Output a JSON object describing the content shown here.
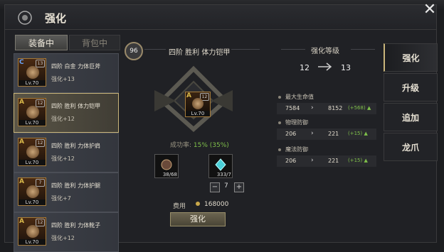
{
  "header": {
    "title": "强化"
  },
  "tabs": [
    "装备中",
    "背包中"
  ],
  "equipment_list": [
    {
      "grade": "C",
      "stars": "13",
      "level": "Lv.70",
      "name": "四阶 白金 力体巨斧",
      "enhance": "强化+13"
    },
    {
      "grade": "A",
      "stars": "12",
      "level": "Lv.70",
      "name": "四阶 胜利 体力铠甲",
      "enhance": "强化+12"
    },
    {
      "grade": "A",
      "stars": "12",
      "level": "Lv.70",
      "name": "四阶 胜利 力体护肩",
      "enhance": "强化+12"
    },
    {
      "grade": "A",
      "stars": "7",
      "level": "Lv.70",
      "name": "四阶 胜利 力体护腿",
      "enhance": "强化+7"
    },
    {
      "grade": "A",
      "stars": "12",
      "level": "Lv.70",
      "name": "四阶 胜利 力体靴子",
      "enhance": "强化+12"
    }
  ],
  "center": {
    "level_badge": "96",
    "item_title": "四阶 胜利 体力铠甲",
    "item": {
      "grade": "A",
      "stars": "12",
      "level": "Lv.70"
    },
    "success_label": "成功率:",
    "success_value": "15% (35%)",
    "materials": [
      {
        "count": "38/68"
      },
      {
        "count": "333/7"
      }
    ],
    "quantity": "7",
    "minus": "−",
    "plus": "+",
    "fee_label": "费用",
    "fee_value": "168000",
    "enhance_button": "强化"
  },
  "level": {
    "heading": "强化等级",
    "from": "12",
    "to": "13"
  },
  "stats": [
    {
      "label": "最大生命值",
      "from": "7584",
      "to": "8152",
      "inc": "(+568)"
    },
    {
      "label": "物理防御",
      "from": "206",
      "to": "221",
      "inc": "(+15)"
    },
    {
      "label": "魔法防御",
      "from": "206",
      "to": "221",
      "inc": "(+15)"
    }
  ],
  "stat_arrow": "›",
  "inc_arrow": "▲",
  "nav": [
    "强化",
    "升级",
    "追加",
    "龙爪"
  ],
  "colors": {
    "accent": "#c9b57a",
    "positive": "#7fbf4a",
    "rate": "#7fbf4a"
  }
}
